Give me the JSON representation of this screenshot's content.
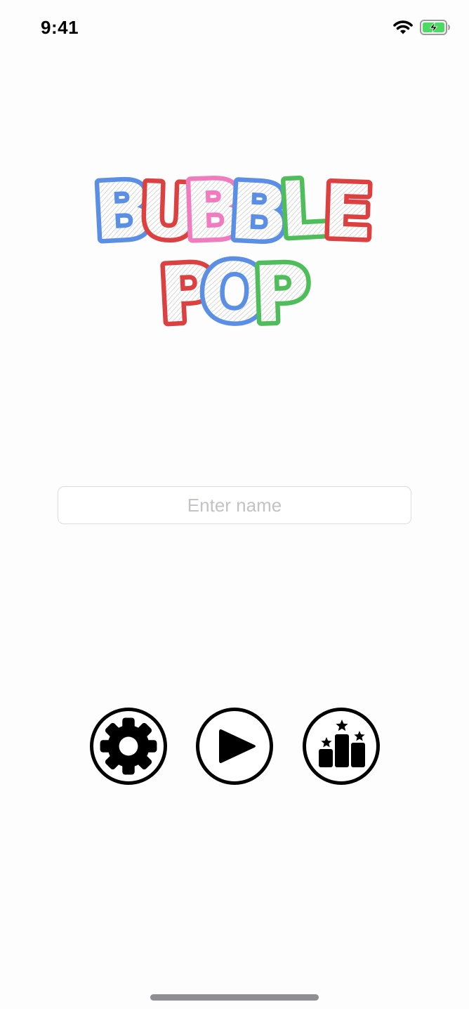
{
  "status_bar": {
    "time": "9:41",
    "icons": [
      "wifi-icon",
      "battery-charging-icon"
    ],
    "battery_color": "#4cd964"
  },
  "logo": {
    "lines": [
      [
        {
          "char": "B",
          "color": "#5b8fe5"
        },
        {
          "char": "U",
          "color": "#dc4040"
        },
        {
          "char": "B",
          "color": "#f07cbf"
        },
        {
          "char": "B",
          "color": "#5b8fe5"
        },
        {
          "char": "L",
          "color": "#4fbe5a"
        },
        {
          "char": "E",
          "color": "#dc4040"
        }
      ],
      [
        {
          "char": "P",
          "color": "#dc4040"
        },
        {
          "char": "O",
          "color": "#5b8fe5"
        },
        {
          "char": "P",
          "color": "#4fbe5a"
        }
      ]
    ]
  },
  "name_input": {
    "placeholder": "Enter name",
    "value": ""
  },
  "buttons": {
    "settings": {
      "icon": "gear-icon"
    },
    "play": {
      "icon": "play-icon"
    },
    "leaderboard": {
      "icon": "podium-icon"
    }
  }
}
